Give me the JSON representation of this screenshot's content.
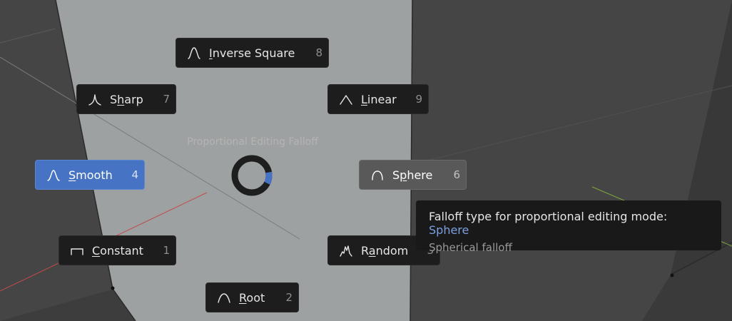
{
  "pie_menu": {
    "title": "Proportional Editing Falloff",
    "items": [
      {
        "id": "inverse-square",
        "pre": "",
        "ul": "I",
        "post": "nverse Square",
        "key": "8",
        "icon": "inverse-square-falloff-icon"
      },
      {
        "id": "sharp",
        "pre": "S",
        "ul": "h",
        "post": "arp",
        "key": "7",
        "icon": "sharp-falloff-icon"
      },
      {
        "id": "linear",
        "pre": "",
        "ul": "L",
        "post": "inear",
        "key": "9",
        "icon": "linear-falloff-icon"
      },
      {
        "id": "smooth",
        "pre": "",
        "ul": "S",
        "post": "mooth",
        "key": "4",
        "icon": "smooth-falloff-icon",
        "state": "active"
      },
      {
        "id": "sphere",
        "pre": "S",
        "ul": "p",
        "post": "here",
        "key": "6",
        "icon": "sphere-falloff-icon",
        "state": "hover"
      },
      {
        "id": "constant",
        "pre": "",
        "ul": "C",
        "post": "onstant",
        "key": "1",
        "icon": "constant-falloff-icon"
      },
      {
        "id": "random",
        "pre": "R",
        "ul": "a",
        "post": "ndom",
        "key": "3",
        "icon": "random-falloff-icon"
      },
      {
        "id": "root",
        "pre": "",
        "ul": "R",
        "post": "oot",
        "key": "2",
        "icon": "root-falloff-icon"
      }
    ]
  },
  "tooltip": {
    "line1_prefix": "Falloff type for proportional editing mode: ",
    "line1_value": "Sphere",
    "line2": "Spherical falloff"
  },
  "colors": {
    "active": "#4673c4",
    "hover": "#595959",
    "item_bg": "#1d1d1d",
    "highlight_text": "#7b9fe0"
  }
}
